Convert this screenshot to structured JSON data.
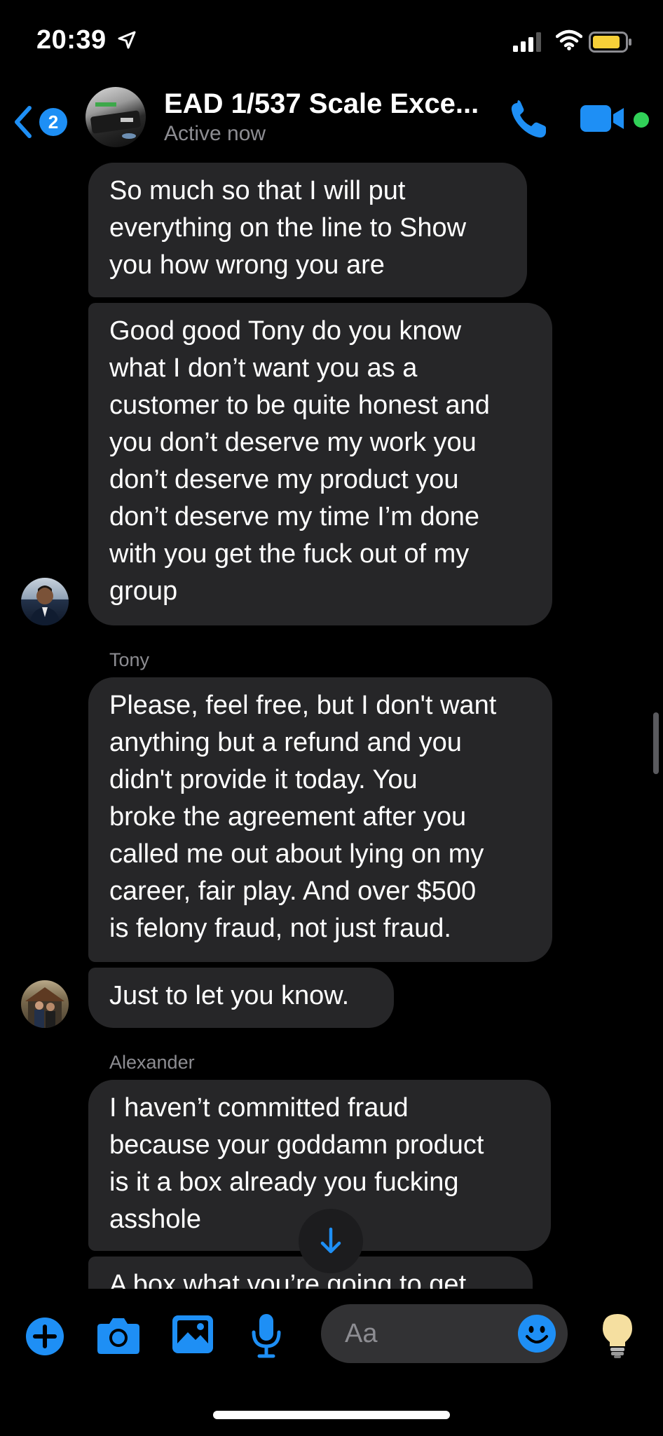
{
  "status_bar": {
    "time": "20:39"
  },
  "header": {
    "back_badge": "2",
    "title": "EAD 1/537  Scale Exce...",
    "status": "Active now"
  },
  "messages": [
    {
      "sender": "",
      "lines": [
        "So much so that I will put",
        "everything on the line to Show",
        "you how wrong you are"
      ]
    },
    {
      "sender": "",
      "lines": [
        "Good good Tony do you know",
        "what I don’t want you as a",
        "customer to be quite honest and",
        "you don’t deserve my work you",
        "don’t deserve my product you",
        "don’t deserve my time I’m done",
        "with you get the fuck out of my",
        "group"
      ]
    },
    {
      "sender": "Tony",
      "lines": [
        "Please, feel free, but I don't want",
        "anything but a refund and you",
        "didn't provide it today.  You",
        "broke the agreement after you",
        "called me out about lying on my",
        "career, fair play.  And over $500",
        "is felony fraud, not just fraud."
      ]
    },
    {
      "sender": "",
      "lines": [
        "Just to let you know."
      ]
    },
    {
      "sender": "Alexander",
      "lines": [
        "I haven’t committed fraud",
        "because your goddamn product",
        "is it a box already you fucking",
        "asshole"
      ]
    },
    {
      "sender": "",
      "lines": [
        "A box what you’re going to get"
      ]
    }
  ],
  "composer": {
    "placeholder": "Aa"
  },
  "colors": {
    "accent": "#1e8ff5",
    "bubble": "#262628",
    "online": "#31d158"
  }
}
